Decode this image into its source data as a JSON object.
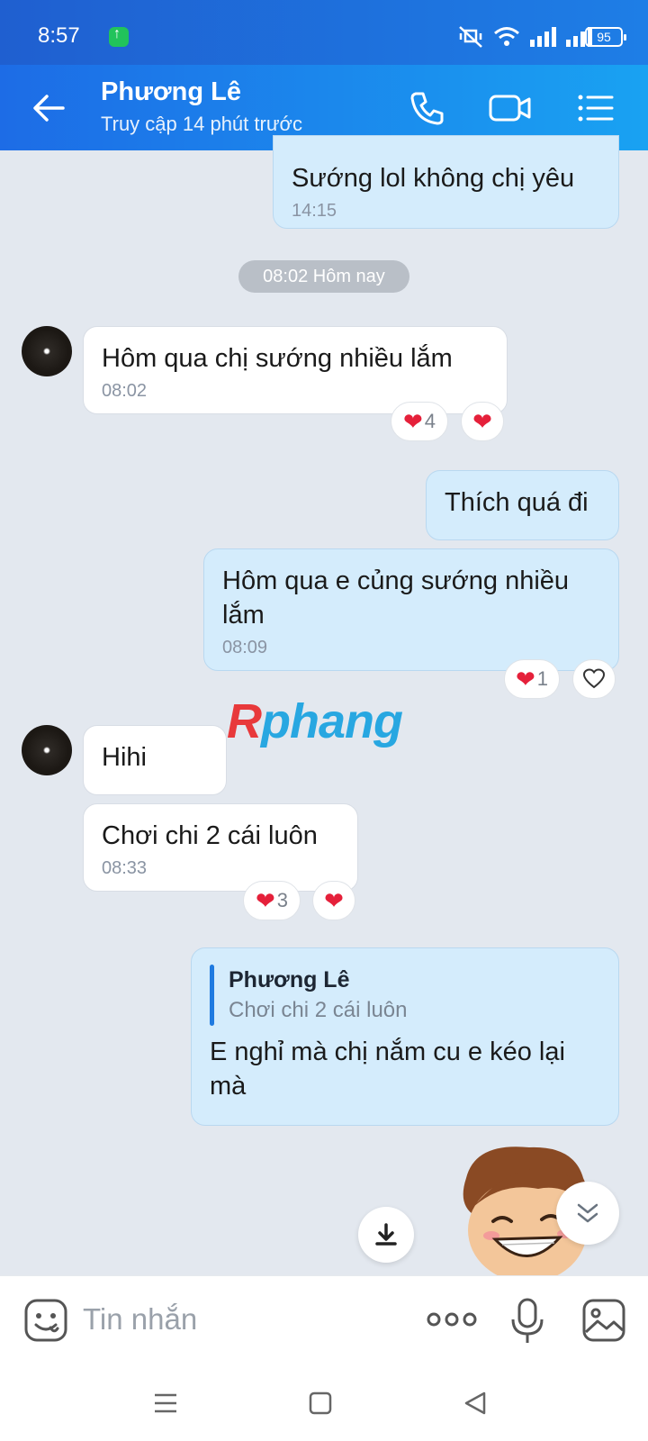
{
  "status_bar": {
    "time": "8:57",
    "battery": "95"
  },
  "header": {
    "contact_name": "Phương Lê",
    "last_seen": "Truy cập 14 phút trước"
  },
  "messages": {
    "m1": {
      "text": "Sướng lol không chị yêu",
      "time": "14:15"
    },
    "date_divider": "08:02 Hôm nay",
    "m2": {
      "text": "Hôm qua chị sướng nhiều lắm",
      "time": "08:02",
      "reaction_count": "4"
    },
    "m3": {
      "text": "Thích quá đi"
    },
    "m4": {
      "text": "Hôm qua e củng sướng nhiều lắm",
      "time": "08:09",
      "reaction_count": "1"
    },
    "m5": {
      "text": "Hihi"
    },
    "m6": {
      "text": "Chơi chi 2 cái luôn",
      "time": "08:33",
      "reaction_count": "3"
    },
    "m7": {
      "quote_name": "Phương Lê",
      "quote_text": "Chơi chi 2 cái luôn",
      "text": "E nghỉ mà chị nắm cu e kéo lại mà"
    }
  },
  "watermark": {
    "first": "R",
    "rest": "phang"
  },
  "composer": {
    "placeholder": "Tin nhắn"
  },
  "colors": {
    "header_start": "#1d6ce6",
    "header_end": "#19a2f2",
    "bubble_out": "#d4ecfc",
    "heart": "#e5203a"
  }
}
